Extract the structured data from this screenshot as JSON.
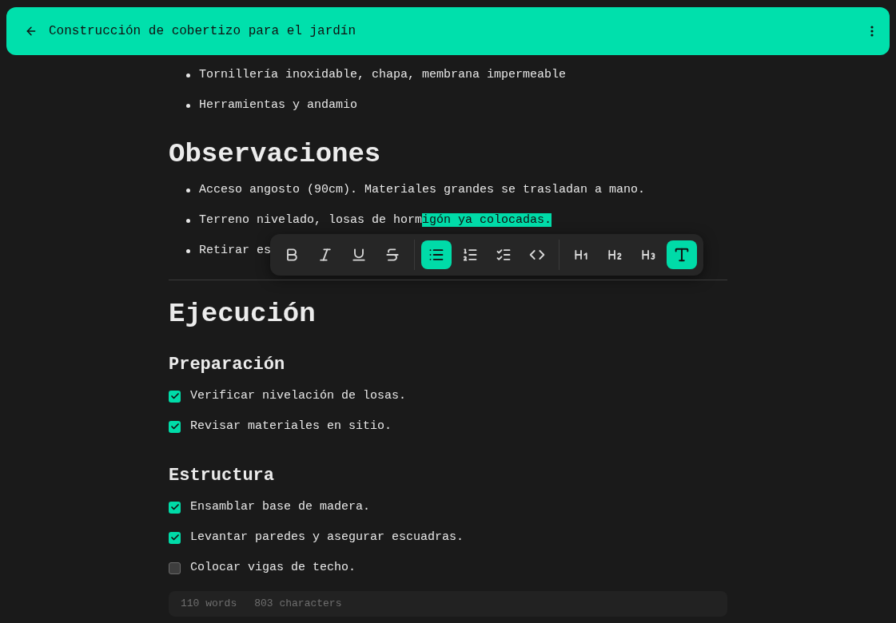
{
  "header": {
    "title": "Construcción de cobertizo para el jardín"
  },
  "blocks": [
    {
      "kind": "bullet",
      "segments": [
        {
          "text": "Tornillería inoxidable, chapa, membrana impermeable",
          "selected": false
        }
      ]
    },
    {
      "kind": "bullet",
      "segments": [
        {
          "text": "Herramientas y andamio",
          "selected": false
        }
      ]
    },
    {
      "kind": "heading1",
      "text": "Observaciones"
    },
    {
      "kind": "bullet",
      "segments": [
        {
          "text": "Acceso angosto (90cm). Materiales grandes se trasladan a mano.",
          "selected": false
        }
      ]
    },
    {
      "kind": "bullet",
      "segments": [
        {
          "text": "Terreno nivelado, losas de horm",
          "selected": false
        },
        {
          "text": "igón ya colocadas.",
          "selected": true
        }
      ]
    },
    {
      "kind": "bullet",
      "segments": [
        {
          "text": "Retirar es",
          "selected": false
        }
      ]
    },
    {
      "kind": "rule"
    },
    {
      "kind": "heading1",
      "text": "Ejecución"
    },
    {
      "kind": "heading2",
      "text": "Preparación"
    },
    {
      "kind": "task",
      "text": "Verificar nivelación de losas.",
      "checked": true
    },
    {
      "kind": "task",
      "text": "Revisar materiales en sitio.",
      "checked": true
    },
    {
      "kind": "heading2",
      "text": "Estructura"
    },
    {
      "kind": "task",
      "text": "Ensamblar base de madera.",
      "checked": true
    },
    {
      "kind": "task",
      "text": "Levantar paredes y asegurar escuadras.",
      "checked": true
    },
    {
      "kind": "task",
      "text": "Colocar vigas de techo.",
      "checked": false
    }
  ],
  "toolbar": {
    "groups": [
      [
        {
          "kind": "bold",
          "selected": false
        },
        {
          "kind": "italic",
          "selected": false
        },
        {
          "kind": "underline",
          "selected": false
        },
        {
          "kind": "strike",
          "selected": false
        }
      ],
      [
        {
          "kind": "bullet-list",
          "selected": true
        },
        {
          "kind": "ordered-list",
          "selected": false
        },
        {
          "kind": "task-list",
          "selected": false
        },
        {
          "kind": "code",
          "selected": false
        }
      ],
      [
        {
          "kind": "heading-1",
          "selected": false
        },
        {
          "kind": "heading-2",
          "selected": false
        },
        {
          "kind": "heading-3",
          "selected": false
        },
        {
          "kind": "paragraph",
          "selected": true
        }
      ]
    ]
  },
  "status_bar": {
    "words": "110 words",
    "characters": "803 characters"
  }
}
